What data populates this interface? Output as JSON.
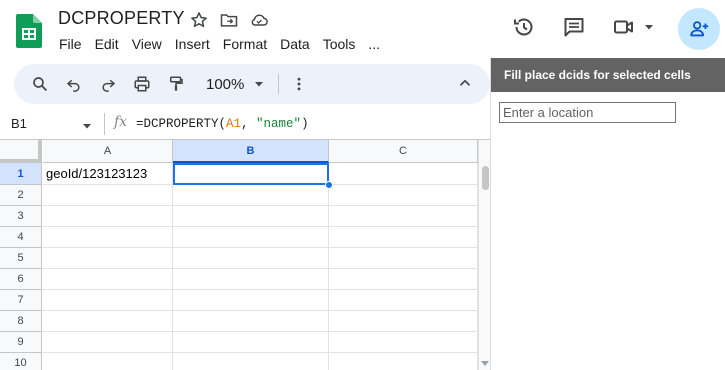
{
  "app": {
    "title": "DCPROPERTY",
    "menus": [
      "File",
      "Edit",
      "View",
      "Insert",
      "Format",
      "Data",
      "Tools",
      "..."
    ]
  },
  "toolbar": {
    "zoom": "100%"
  },
  "formula_bar": {
    "cell_ref": "B1",
    "fx": "fx",
    "formula_prefix": "=DCPROPERTY(",
    "formula_ref": "A1",
    "formula_sep": ", ",
    "formula_str": "\"name\"",
    "formula_suffix": ")"
  },
  "sheet": {
    "columns": [
      "A",
      "B",
      "C"
    ],
    "rows": [
      "1",
      "2",
      "3",
      "4",
      "5",
      "6",
      "7",
      "8",
      "9",
      "10"
    ],
    "selected_column": "B",
    "selected_row": "1",
    "cells": {
      "A1": "geoId/123123123",
      "B1": ""
    }
  },
  "side_panel": {
    "title": "Fill place dcids for selected cells",
    "location_placeholder": "Enter a location",
    "location_value": ""
  },
  "colors": {
    "accent": "#1a73e8",
    "toolbar_bg": "#edf2fa",
    "share_bg": "#c2e7ff",
    "panel_header_bg": "#636363",
    "sheets_green": "#0f9d58"
  }
}
